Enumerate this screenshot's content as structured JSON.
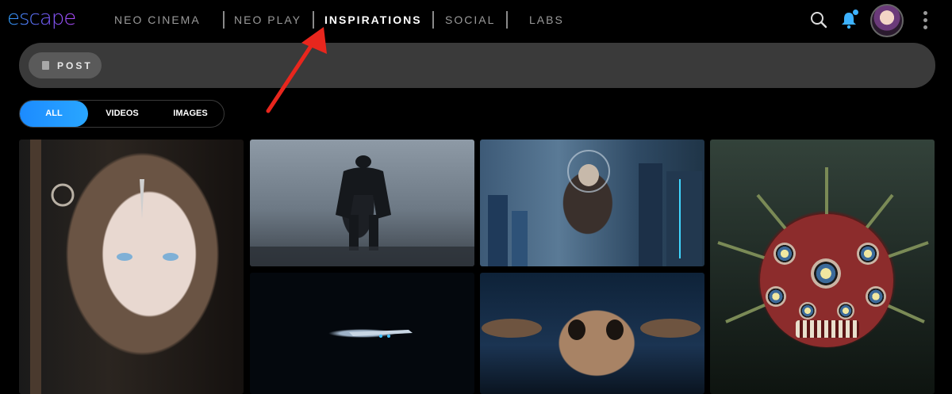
{
  "header": {
    "logo_text": "escape",
    "nav": [
      {
        "label": "NEO CINEMA"
      },
      {
        "label": "NEO PLAY"
      },
      {
        "label": "INSPIRATIONS",
        "active": true
      },
      {
        "label": "SOCIAL"
      },
      {
        "label": "LABS"
      }
    ],
    "icons": {
      "search": "search-icon",
      "notifications": "bell-icon",
      "avatar": "avatar",
      "more": "more-vertical-icon"
    }
  },
  "post": {
    "label": "POST"
  },
  "filters": {
    "tabs": [
      {
        "label": "ALL",
        "active": true
      },
      {
        "label": "VIDEOS"
      },
      {
        "label": "IMAGES"
      }
    ]
  },
  "colors": {
    "accent": "#1c8bff",
    "arrow": "#e8261d",
    "bar": "#3a3a3a"
  },
  "gallery": [
    {
      "subject": "pale warrior with staff"
    },
    {
      "subject": "giant dark creature in fog"
    },
    {
      "subject": "creature on city rooftop"
    },
    {
      "subject": "spaceship in darkness"
    },
    {
      "subject": "small alien creature"
    },
    {
      "subject": "many-eyed monster"
    }
  ]
}
